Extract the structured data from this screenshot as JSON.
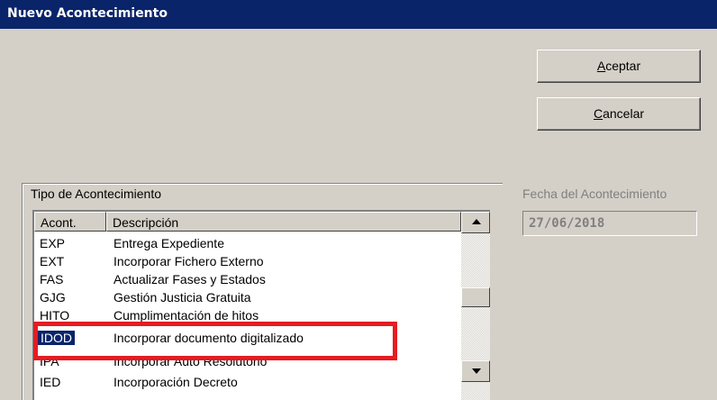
{
  "window": {
    "title": "Nuevo Acontecimiento"
  },
  "buttons": {
    "accept": {
      "mnemonic": "A",
      "rest": "ceptar"
    },
    "cancel": {
      "mnemonic": "C",
      "rest": "ancelar"
    }
  },
  "event_type": {
    "group_label": "Tipo de Acontecimiento",
    "columns": [
      "Acont.",
      "Descripción"
    ],
    "rows": [
      {
        "code": "EXP",
        "description": "Entrega Expediente"
      },
      {
        "code": "EXT",
        "description": "Incorporar Fichero Externo"
      },
      {
        "code": "FAS",
        "description": "Actualizar Fases y Estados"
      },
      {
        "code": "GJG",
        "description": "Gestión Justicia Gratuita"
      },
      {
        "code": "HITO",
        "description": "Cumplimentación de hitos"
      },
      {
        "code": "IDOD",
        "description": "Incorporar documento digitalizado",
        "selected": true
      },
      {
        "code": "IPA",
        "description": "Incorporar Auto Resolutorio"
      },
      {
        "code": "IED",
        "description": "Incorporación Decreto"
      }
    ]
  },
  "event_date": {
    "label": "Fecha del Acontecimiento",
    "value": "27/06/2018"
  },
  "colors": {
    "title_bar": "#0a246a",
    "highlight_box": "#e51c23"
  }
}
